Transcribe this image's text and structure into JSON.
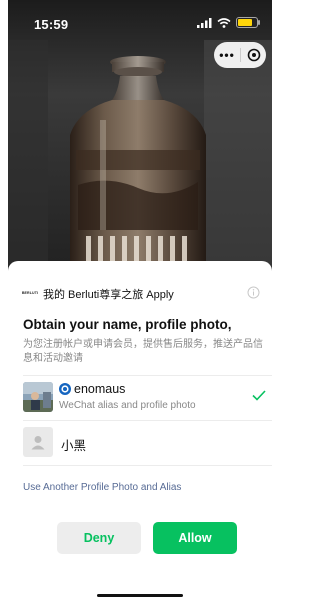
{
  "status_bar": {
    "time": "15:59",
    "signal_icon": "signal-bars-icon",
    "wifi_icon": "wifi-icon",
    "battery_icon": "battery-icon",
    "battery_level": 0.8,
    "battery_color": "#ffd60a"
  },
  "capsule": {
    "more_label": "•••",
    "more_icon": "more-dots-icon",
    "close_icon": "close-circle-icon"
  },
  "background": {
    "subject": "glass bottle",
    "subject_icon": "bottle-image"
  },
  "auth_sheet": {
    "app_logo_text": "BERLUTI",
    "app_name": "我的 Berluti尊享之旅 Apply",
    "info_icon": "info-icon",
    "title": "Obtain your name, profile photo,",
    "description": "为您注册帐户或申请会员，提供售后服务，推送产品信息和活动邀请",
    "profiles": [
      {
        "name": "enomaus",
        "subtitle": "WeChat alias and profile photo",
        "selected": true,
        "badge_icon": "blue-eye-badge-icon",
        "avatar_icon": "profile-photo-avatar"
      },
      {
        "name": "小黑",
        "selected": false,
        "avatar_icon": "default-user-avatar-icon"
      }
    ],
    "check_icon": "checkmark-icon",
    "use_another_link": "Use Another Profile Photo and Alias",
    "deny_label": "Deny",
    "allow_label": "Allow"
  },
  "colors": {
    "accent_green": "#07c160",
    "link_blue": "#576b95",
    "secondary_text": "#888888",
    "deny_bg": "#ededed"
  }
}
